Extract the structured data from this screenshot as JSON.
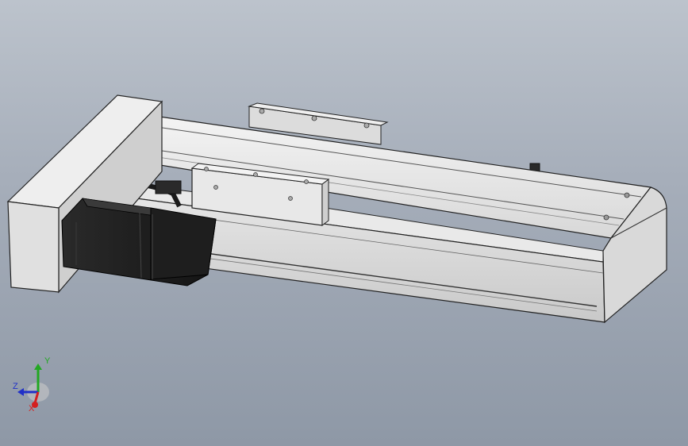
{
  "viewport": {
    "background_top": "#bcc3cc",
    "background_bottom": "#8e98a6"
  },
  "model": {
    "parts": [
      "end-mount-block",
      "motor",
      "linear-rail-body",
      "carriage",
      "rear-mount-plate",
      "end-cap"
    ]
  },
  "triad": {
    "x_label": "X",
    "y_label": "Y",
    "z_label": "Z",
    "x_color": "#d42020",
    "y_color": "#22a822",
    "z_color": "#2030c8"
  }
}
